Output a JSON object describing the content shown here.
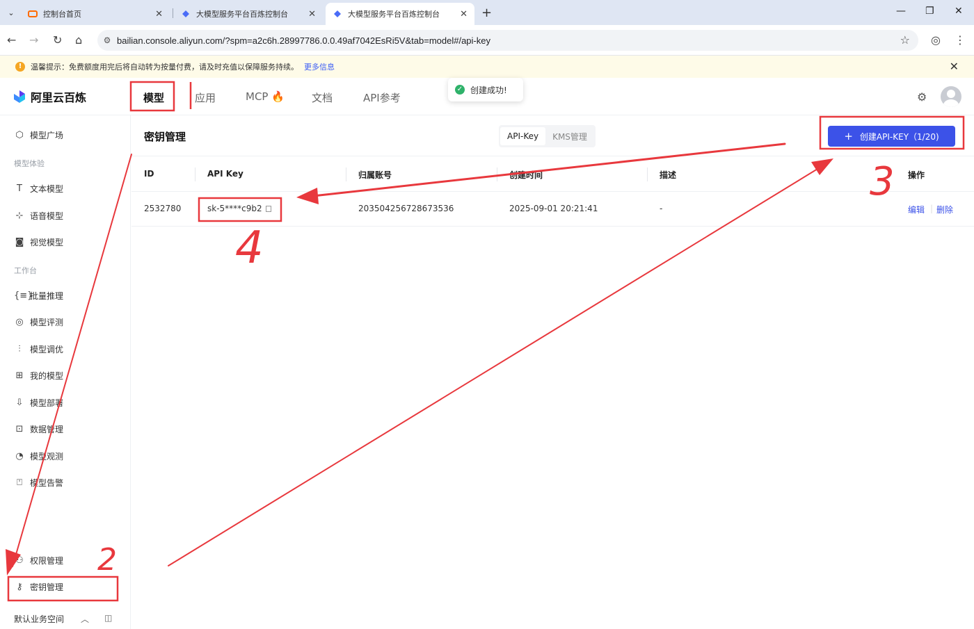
{
  "browser": {
    "tabs": [
      {
        "title": "控制台首页",
        "active": false
      },
      {
        "title": "大模型服务平台百炼控制台",
        "active": false
      },
      {
        "title": "大模型服务平台百炼控制台",
        "active": true
      }
    ],
    "url": "bailian.console.aliyun.com/?spm=a2c6h.28997786.0.0.49af7042EsRi5V&tab=model#/api-key"
  },
  "notice": {
    "text": "温馨提示：免费额度用完后将自动转为按量付费，请及时充值以保障服务持续。",
    "link": "更多信息"
  },
  "header": {
    "logo": "阿里云百炼",
    "nav": [
      "模型",
      "应用",
      "MCP",
      "文档",
      "API参考"
    ],
    "toast": "创建成功!"
  },
  "sidebar": {
    "top_item": "模型广场",
    "group1": "模型体验",
    "group1_items": [
      "文本模型",
      "语音模型",
      "视觉模型"
    ],
    "group2": "工作台",
    "group2_items": [
      "批量推理",
      "模型评测",
      "模型调优",
      "我的模型",
      "模型部署",
      "数据管理",
      "模型观测",
      "模型告警"
    ],
    "bottom_items": [
      "权限管理",
      "密钥管理"
    ],
    "footer": "默认业务空间"
  },
  "main": {
    "title": "密钥管理",
    "segments": [
      "API-Key",
      "KMS管理"
    ],
    "create_button": "创建API-KEY（1/20)",
    "columns": [
      "ID",
      "API Key",
      "归属账号",
      "创建时间",
      "描述",
      "操作"
    ],
    "rows": [
      {
        "id": "2532780",
        "key": "sk-5****c9b2",
        "account": "203504256728673536",
        "created": "2025-09-01 20:21:41",
        "desc": "-",
        "edit": "编辑",
        "delete": "删除"
      }
    ]
  },
  "annotations": {
    "num2": "2",
    "num3": "3",
    "num4": "4"
  },
  "colors": {
    "accent": "#3c52e8",
    "annotation": "#e8383d",
    "notice_bg": "#fefbe8",
    "tabbar": "#dfe6f3"
  }
}
